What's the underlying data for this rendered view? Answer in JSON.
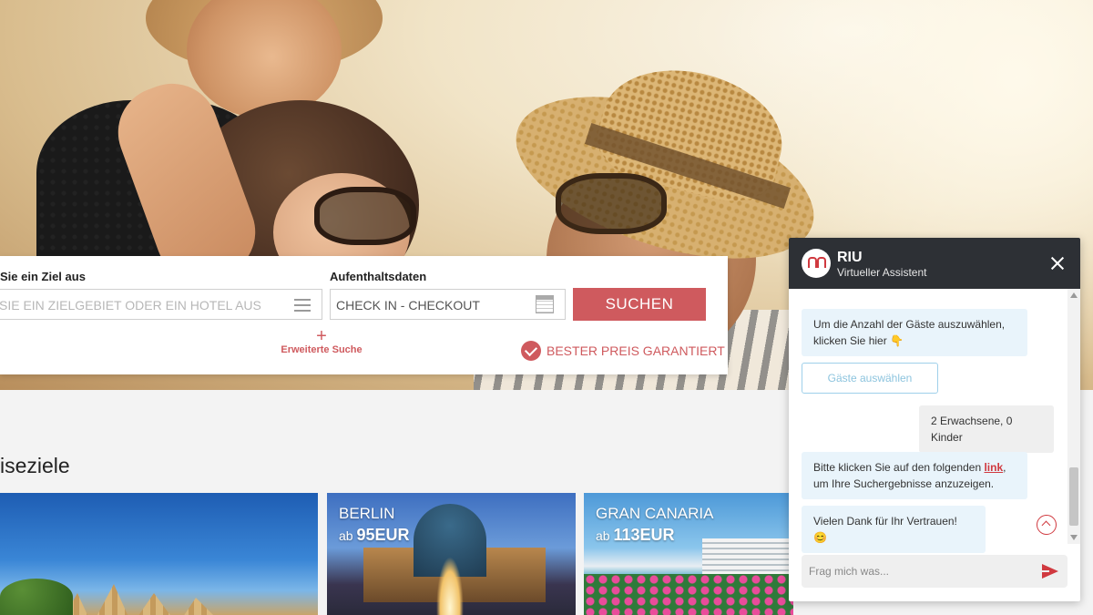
{
  "search": {
    "destination_label": "Sie ein Ziel aus",
    "destination_placeholder": "SIE EIN ZIELGEBIET ODER EIN HOTEL AUS",
    "dates_label": "Aufenthaltsdaten",
    "dates_value": "CHECK IN - CHECKOUT",
    "submit_label": "SUCHEN",
    "advanced_plus": "+",
    "advanced_label": "Erweiterte Suche",
    "guarantee_label": "BESTER PREIS GARANTIERT"
  },
  "destinations": {
    "title": "iseziele",
    "cards": [
      {
        "name": "",
        "price_prefix": "",
        "price": ""
      },
      {
        "name": "BERLIN",
        "price_prefix": "ab ",
        "price": "95EUR"
      },
      {
        "name": "GRAN CANARIA",
        "price_prefix": "ab ",
        "price": "113EUR"
      }
    ]
  },
  "chat": {
    "name": "RIU",
    "subtitle": "Virtueller Assistent",
    "messages": {
      "bot1": "Um die Anzahl der Gäste auszuwählen, klicken Sie hier 👇",
      "guests_button": "Gäste auswählen",
      "user1": "2 Erwachsene, 0 Kinder",
      "bot2_before": "Bitte klicken Sie auf den folgenden ",
      "bot2_link": "link",
      "bot2_after": ", um Ihre Suchergebnisse anzuzeigen.",
      "bot3": "Vielen Dank für Ihr Vertrauen! 😊"
    },
    "input_placeholder": "Frag mich was..."
  },
  "colors": {
    "accent": "#cf5a5e",
    "chat_header": "#2d3035",
    "bot_bubble": "#e9f4fb"
  },
  "icons": {
    "menu": "hamburger-icon",
    "calendar": "calendar-icon",
    "guarantee": "check-badge-icon",
    "close": "close-icon",
    "send": "send-icon",
    "scroll_up": "chevron-up-icon",
    "logo": "riu-logo"
  }
}
